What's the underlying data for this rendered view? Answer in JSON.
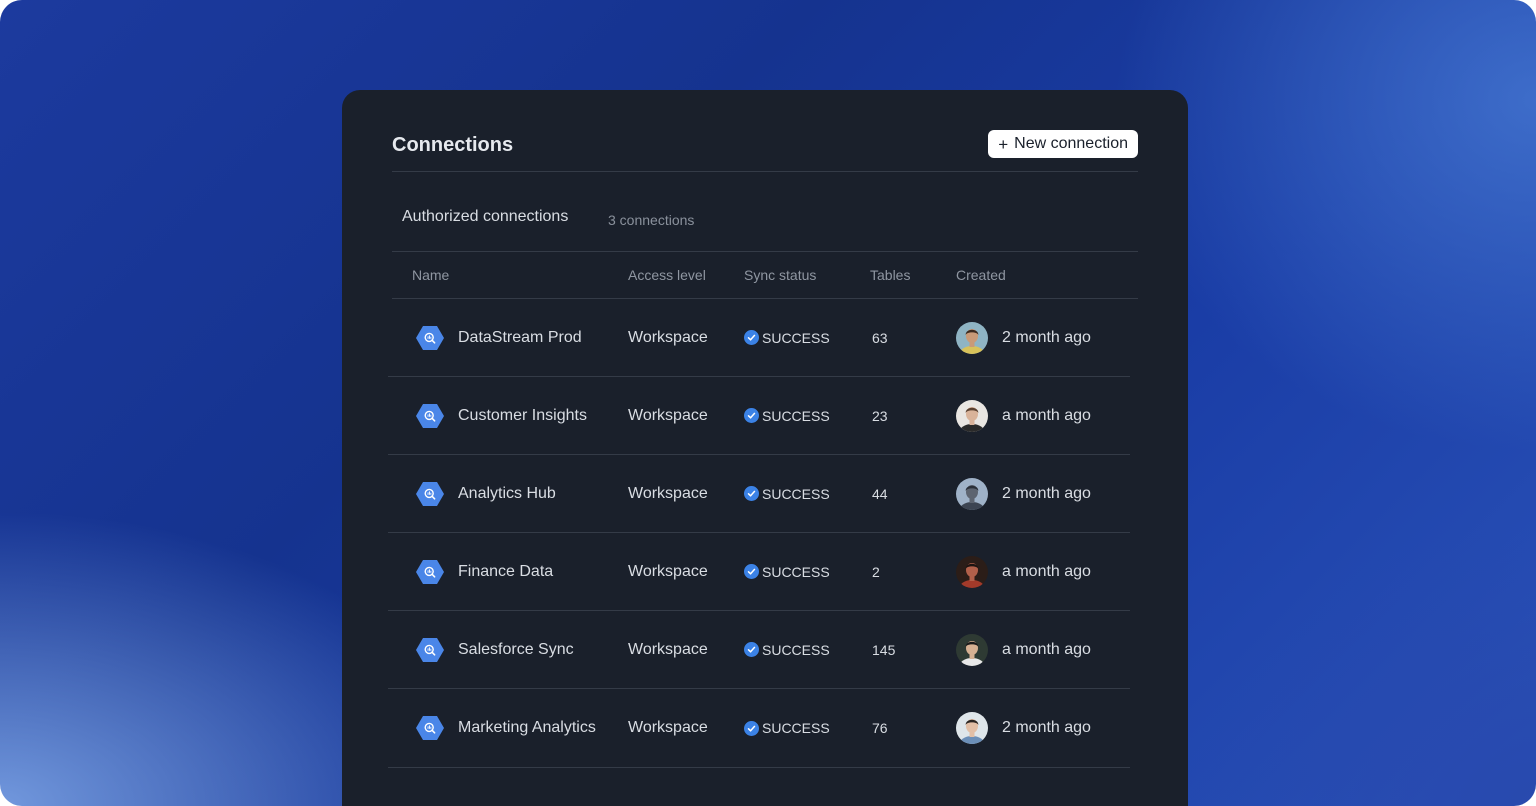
{
  "header": {
    "title": "Connections",
    "new_button_label": "New connection"
  },
  "section": {
    "title": "Authorized connections",
    "count": "3 connections"
  },
  "columns": {
    "name": "Name",
    "access": "Access level",
    "status": "Sync status",
    "tables": "Tables",
    "created": "Created"
  },
  "rows": [
    {
      "name": "DataStream Prod",
      "access": "Workspace",
      "status": "SUCCESS",
      "tables": "63",
      "created": "2 month ago",
      "avatar": "avatar-1"
    },
    {
      "name": "Customer Insights",
      "access": "Workspace",
      "status": "SUCCESS",
      "tables": "23",
      "created": "a month ago",
      "avatar": "avatar-2"
    },
    {
      "name": "Analytics Hub",
      "access": "Workspace",
      "status": "SUCCESS",
      "tables": "44",
      "created": "2 month ago",
      "avatar": "avatar-3"
    },
    {
      "name": "Finance Data",
      "access": "Workspace",
      "status": "SUCCESS",
      "tables": "2",
      "created": "a month ago",
      "avatar": "avatar-4"
    },
    {
      "name": "Salesforce Sync",
      "access": "Workspace",
      "status": "SUCCESS",
      "tables": "145",
      "created": "a month ago",
      "avatar": "avatar-5"
    },
    {
      "name": "Marketing Analytics",
      "access": "Workspace",
      "status": "SUCCESS",
      "tables": "76",
      "created": "2 month ago",
      "avatar": "avatar-6"
    }
  ],
  "icons": {
    "connection": "bigquery-hexagon-icon",
    "status": "check-circle-icon",
    "add": "plus-icon"
  },
  "colors": {
    "card_bg": "#1a202b",
    "accent_blue": "#3b82e6",
    "hex_blue": "#4a86e8",
    "text": "#d9dde3",
    "muted": "#8f96a1"
  }
}
